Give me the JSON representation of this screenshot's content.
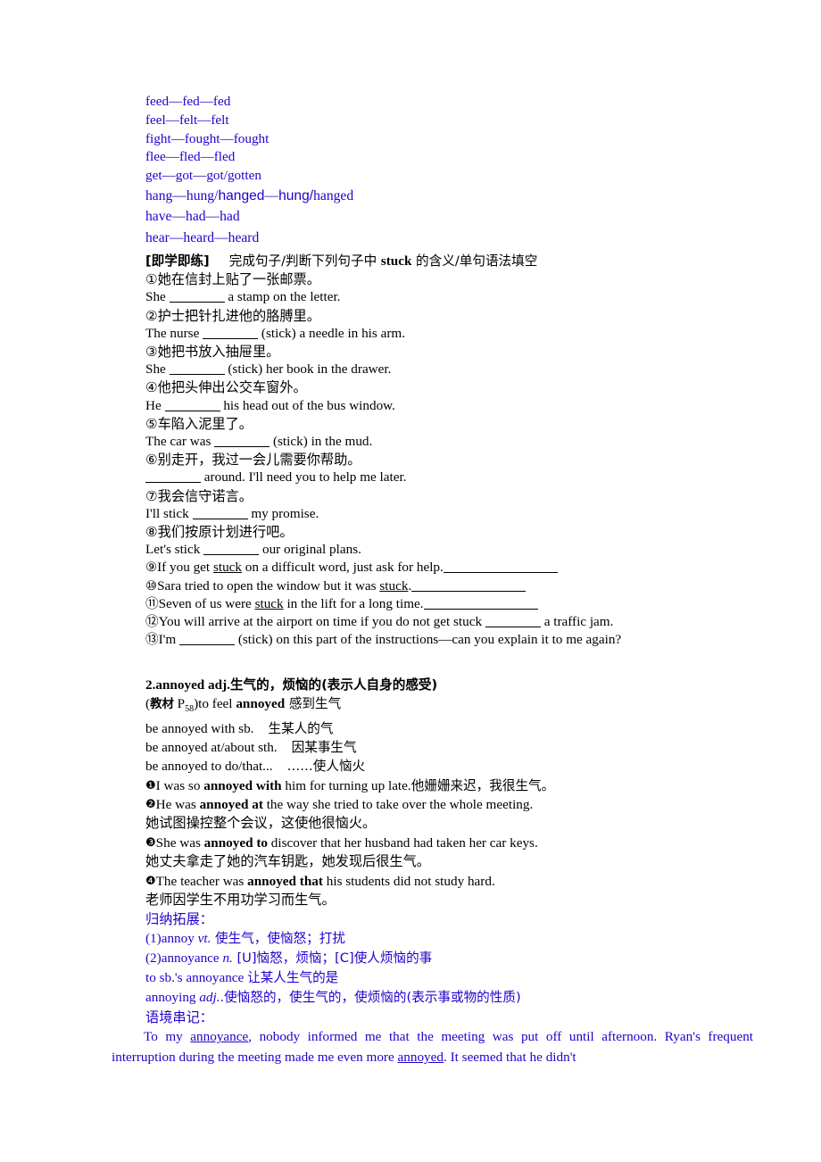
{
  "colors": {
    "blue": "#2200cc",
    "black": "#000000"
  },
  "verb_list": [
    {
      "a": "feed—fed—fed"
    },
    {
      "a": "feel—felt—felt"
    },
    {
      "a": "fight—fought—fought"
    },
    {
      "a": "flee—fled—fled"
    },
    {
      "a": "get—got—got/gotten"
    },
    {
      "a": "hang—hung/",
      "b": "hanged",
      "c": "—",
      "d": "hung/",
      "e": "hanged"
    },
    {
      "a": "have—had—had"
    },
    {
      "a": "hear—heard—heard"
    }
  ],
  "exercise": {
    "tag": "[即学即练]",
    "instruction_1": "完成句子/判断下列句子中 ",
    "instruction_keyword": "stuck",
    "instruction_2": " 的含义/单句语法填空",
    "items": [
      {
        "num": "①",
        "cn": "她在信封上贴了一张邮票。",
        "en_a": "She ",
        "en_b": " a stamp on the letter."
      },
      {
        "num": "②",
        "cn": "护士把针扎进他的胳膊里。",
        "en_a": "The nurse ",
        "en_b": " (stick) a needle in his arm."
      },
      {
        "num": "③",
        "cn": "她把书放入抽屉里。",
        "en_a": "She ",
        "en_b": " (stick) her book in the drawer."
      },
      {
        "num": "④",
        "cn": "他把头伸出公交车窗外。",
        "en_a": "He ",
        "en_b": " his head out of the bus window."
      },
      {
        "num": "⑤",
        "cn": "车陷入泥里了。",
        "en_a": "The car was ",
        "en_b": " (stick) in the mud."
      },
      {
        "num": "⑥",
        "cn": "别走开，我过一会儿需要你帮助。",
        "en_a": "",
        "en_b": " around. I'll need you to help me later."
      },
      {
        "num": "⑦",
        "cn": "我会信守诺言。",
        "en_a": "I'll stick ",
        "en_b": " my promise."
      },
      {
        "num": "⑧",
        "cn": "我们按原计划进行吧。",
        "en_a": "Let's stick ",
        "en_b": " our original plans."
      }
    ],
    "judge_items": [
      {
        "num": "⑨",
        "a": "If you get ",
        "key": "stuck",
        "b": " on a difficult word, just ask for help."
      },
      {
        "num": "⑩",
        "a": "Sara tried to open the window but it was ",
        "key": "stuck",
        "b": "."
      },
      {
        "num": "⑪",
        "a": "Seven of us were ",
        "key": "stuck",
        "b": " in the lift for a long time."
      }
    ],
    "fill_items": [
      {
        "num": "⑫",
        "a": "You will arrive at the airport on time if you do not get stuck ",
        "b": " a traffic jam."
      },
      {
        "num": "⑬",
        "a": "I'm ",
        "b": " (stick) on this part of the instructions—can you explain it to me again?"
      }
    ]
  },
  "entry2": {
    "title_num": "2.",
    "title_word": "annoyed adj.",
    "title_cn": "生气的，烦恼的(表示人自身的感受)",
    "source_book": "教材",
    "source_page_letter": "P",
    "source_page_num": "58",
    "source_text_a": ")to feel ",
    "source_keyword": "annoyed",
    "source_cn": " 感到生气",
    "phrases": [
      {
        "en": "be annoyed with sb.",
        "cn": "生某人的气"
      },
      {
        "en": "be annoyed at/about sth.",
        "cn": "因某事生气"
      },
      {
        "en": "be annoyed to do/that...",
        "cn": "……使人恼火"
      }
    ],
    "examples": [
      {
        "num": "❶",
        "en_a": "I was so ",
        "en_bold": "annoyed with",
        "en_b": " him for turning up late.",
        "cn": "他姗姗来迟，我很生气。",
        "cn_inline": true
      },
      {
        "num": "❷",
        "en_a": "He was ",
        "en_bold": "annoyed at",
        "en_b": " the way she tried to take over the whole meeting.",
        "cn": "她试图操控整个会议，这使他很恼火。",
        "cn_inline": false
      },
      {
        "num": "❸",
        "en_a": "She was ",
        "en_bold": "annoyed to",
        "en_b": " discover that her husband had taken her car keys.",
        "cn": "她丈夫拿走了她的汽车钥匙，她发现后很生气。",
        "cn_inline": false
      },
      {
        "num": "❹",
        "en_a": "The teacher was ",
        "en_bold": "annoyed that",
        "en_b": " his students did not study hard.",
        "cn": "老师因学生不用功学习而生气。",
        "cn_inline": false
      }
    ],
    "extension_title": "归纳拓展：",
    "extension": [
      {
        "a": "(1)annoy ",
        "i": "vt.",
        "b": " 使生气，使恼怒；打扰"
      },
      {
        "a": "(2)annoyance ",
        "i": "n.",
        "b": " [U]恼怒，烦恼；[C]使人烦恼的事"
      },
      {
        "a": "to sb.'s annoyance ",
        "i": "",
        "b": " 让某人生气的是"
      },
      {
        "a": "annoying ",
        "i": "adj.",
        "b": ".使恼怒的，使生气的，使烦恼的(表示事或物的性质)"
      }
    ],
    "context_title": "语境串记：",
    "context_paragraph_parts": {
      "p1": "To my ",
      "u1": "annoyance",
      "p2": ", nobody informed me that the meeting was put off until afternoon. Ryan's frequent interruption during the meeting made me even more ",
      "u2": "annoyed",
      "p3": ". It seemed that he didn't"
    }
  }
}
